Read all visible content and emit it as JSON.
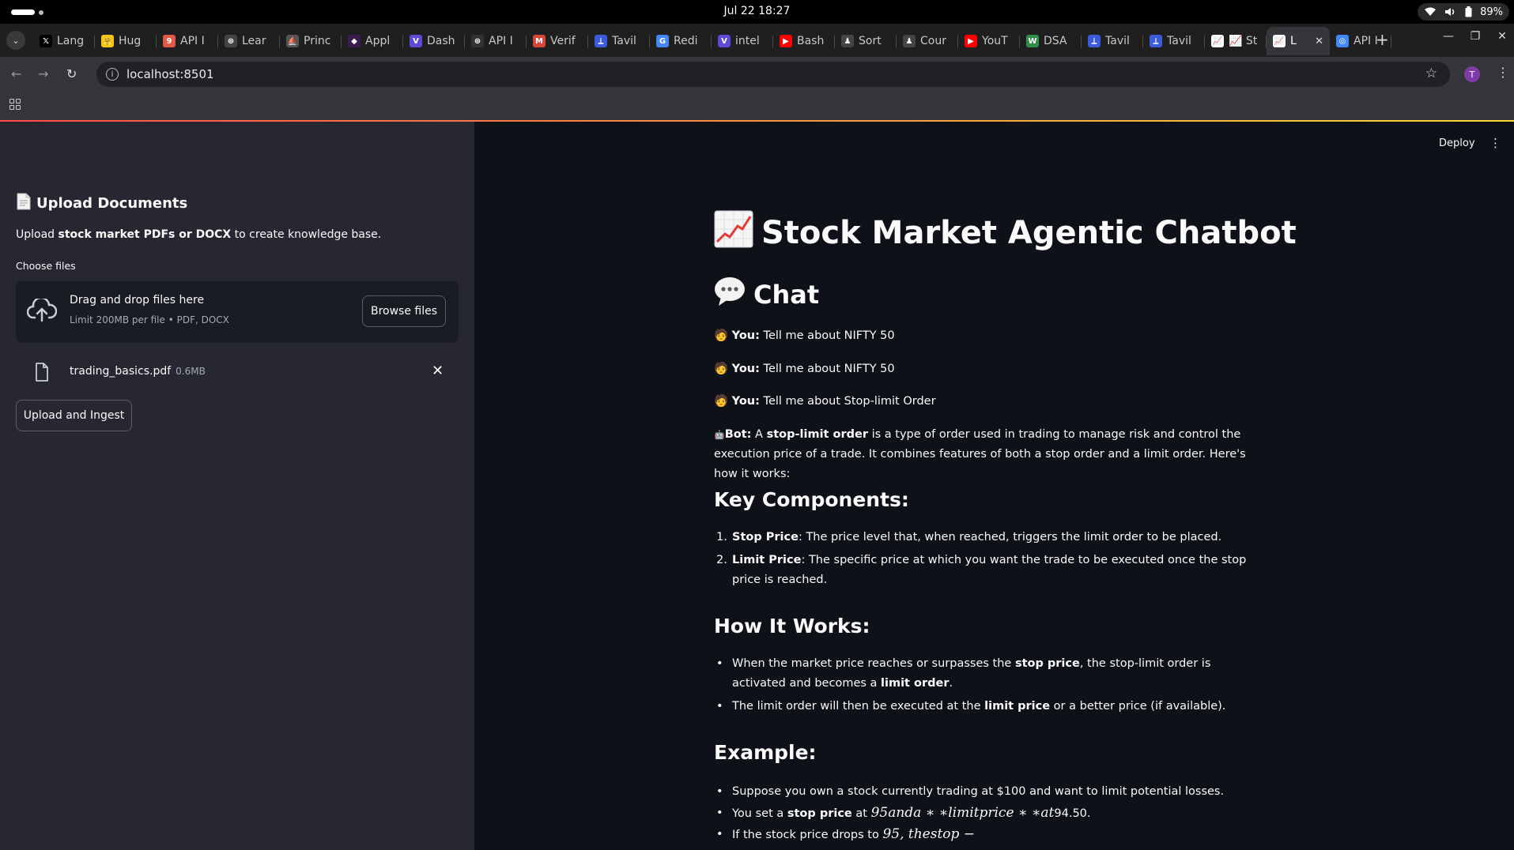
{
  "os": {
    "clock": "Jul 22  18:27",
    "battery": "89%"
  },
  "tabs": [
    {
      "title": "Lang",
      "fav": "𝕏",
      "color": "#000000"
    },
    {
      "title": "Hug",
      "fav": "🤗",
      "color": "#f5c518"
    },
    {
      "title": "API I",
      "fav": "9",
      "color": "#e05a47"
    },
    {
      "title": "Lear",
      "fav": "⊛",
      "color": "#444444"
    },
    {
      "title": "Princ",
      "fav": "⛵",
      "color": "#555555"
    },
    {
      "title": "Appl",
      "fav": "◆",
      "color": "#3a1d4a"
    },
    {
      "title": "Dash",
      "fav": "V",
      "color": "#5b4bd6"
    },
    {
      "title": "API I",
      "fav": "⊛",
      "color": "#333333"
    },
    {
      "title": "Verif",
      "fav": "M",
      "color": "#d44638"
    },
    {
      "title": "Tavil",
      "fav": "⟂",
      "color": "#3b5bdb"
    },
    {
      "title": "Redi",
      "fav": "G",
      "color": "#4285f4"
    },
    {
      "title": "intel",
      "fav": "V",
      "color": "#5b4bd6"
    },
    {
      "title": "Bash",
      "fav": "▶",
      "color": "#ff0000"
    },
    {
      "title": "Sort",
      "fav": "♟",
      "color": "#444444"
    },
    {
      "title": "Cour",
      "fav": "♟",
      "color": "#444444"
    },
    {
      "title": "YouT",
      "fav": "▶",
      "color": "#ff0000"
    },
    {
      "title": "DSA",
      "fav": "W",
      "color": "#2f8f46"
    },
    {
      "title": "Tavil",
      "fav": "⟂",
      "color": "#3b5bdb"
    },
    {
      "title": "Tavil",
      "fav": "⟂",
      "color": "#3b5bdb"
    },
    {
      "title": "📈 St",
      "fav": "📈",
      "color": "#ffffff"
    },
    {
      "title": "L",
      "fav": "📈",
      "color": "#ffffff",
      "active": true
    },
    {
      "title": "API I",
      "fav": "◎",
      "color": "#4285f4"
    }
  ],
  "address": {
    "url": "localhost:8501"
  },
  "profile_initial": "T",
  "sidebar": {
    "title": "Upload Documents",
    "desc_pre": "Upload ",
    "desc_bold": "stock market PDFs or DOCX",
    "desc_post": " to create knowledge base.",
    "choose_label": "Choose files",
    "dropzone_title": "Drag and drop files here",
    "dropzone_sub": "Limit 200MB per file • PDF, DOCX",
    "browse_label": "Browse files",
    "file_name": "trading_basics.pdf",
    "file_size": "0.6MB",
    "upload_label": "Upload and Ingest"
  },
  "header": {
    "deploy": "Deploy"
  },
  "main": {
    "title": "Stock Market Agentic Chatbot",
    "chat_heading": "Chat",
    "you_label": "You:",
    "bot_label": "Bot:",
    "user_messages": [
      "Tell me about NIFTY 50",
      "Tell me about NIFTY 50",
      "Tell me about Stop-limit Order"
    ],
    "bot_intro_pre": " A ",
    "bot_intro_bold": "stop-limit order",
    "bot_intro_post": " is a type of order used in trading to manage risk and control the execution price of a trade. It combines features of both a stop order and a limit order. Here's how it works:",
    "key_components_heading": "Key Components:",
    "key_components": [
      {
        "num": "1.",
        "bold": "Stop Price",
        "text": ": The price level that, when reached, triggers the limit order to be placed."
      },
      {
        "num": "2.",
        "bold": "Limit Price",
        "text": ": The specific price at which you want the trade to be executed once the stop price is reached."
      }
    ],
    "how_heading": "How It Works:",
    "how_1_pre": "When the market price reaches or surpasses the ",
    "how_1_bold1": "stop price",
    "how_1_mid": ", the stop-limit order is activated and becomes a ",
    "how_1_bold2": "limit order",
    "how_1_post": ".",
    "how_2_pre": "The limit order will then be executed at the ",
    "how_2_bold": "limit price",
    "how_2_post": " or a better price (if available).",
    "example_heading": "Example:",
    "ex_1": "Suppose you own a stock currently trading at $100 and want to limit potential losses.",
    "ex_2_pre": "You set a ",
    "ex_2_bold": "stop price",
    "ex_2_mid": " at ",
    "ex_2_math": "95anda ∗ ∗limitprice ∗ ∗at",
    "ex_2_post": "94.50.",
    "ex_3_pre": "If the stock price drops to ",
    "ex_3_math": "95, thestop −"
  }
}
